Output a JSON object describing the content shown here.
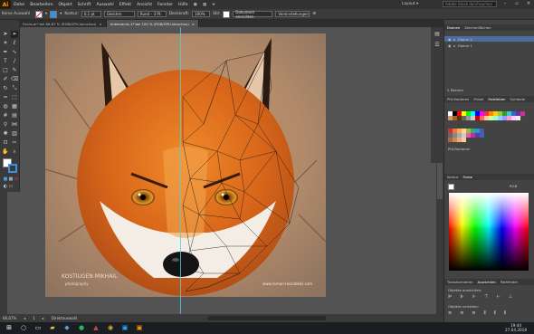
{
  "menubar": {
    "logo": "Ai",
    "items": [
      "Datei",
      "Bearbeiten",
      "Objekt",
      "Schrift",
      "Auswahl",
      "Effekt",
      "Ansicht",
      "Fenster",
      "Hilfe"
    ],
    "layout": "Layout",
    "search_placeholder": "Adobe Stock durchsuchen"
  },
  "controlbar": {
    "label": "Keine Auswahl",
    "stroke_label": "Kontur:",
    "stroke_value": "0,1 pt",
    "brush": "Gleichm.",
    "style": "Rund – 3 Pt.",
    "opacity_label": "Deckkraft:",
    "opacity_value": "100%",
    "style_label": "Stil:",
    "doc_setup": "Dokument einrichten",
    "prefs": "Voreinstellungen"
  },
  "tabs": [
    {
      "label": "Fuchs.ai* bei 66,67 % (RGB/GPU-Vorschau)",
      "close": "×"
    },
    {
      "label": "Unbenannt-1* bei 100 % (RGB/GPU-Vorschau)",
      "close": "×"
    }
  ],
  "status": {
    "zoom": "66,67%",
    "page": "1",
    "tool": "Direktauswahl"
  },
  "watermark": {
    "brand": "KOSTIUGEN MIKHAIL",
    "sub": "photography",
    "url": "www.roman-raisinbkeil.com"
  },
  "panels": {
    "layers_tabs": [
      "Ebenen",
      "Zeichenflächen"
    ],
    "layers": [
      "Ebene 2",
      "Ebene 1"
    ],
    "layers_count": "2 Ebenen",
    "swatches_tabs": [
      "Pfd-Radieren",
      "Pinsel",
      "Farbfelder",
      "Symbole"
    ],
    "swatches_label": "Pfd-Radieren",
    "color_tabs": [
      "Kontur",
      "Farbe"
    ],
    "color_mode": "RGB",
    "transform_tabs": [
      "Transformieren",
      "Ausrichten",
      "Pathfinder"
    ],
    "align_label": "Objekte ausrichten:",
    "distribute_label": "Objekte verteilen:"
  },
  "clock": {
    "time": "19:44",
    "date": "27.04.2018"
  },
  "colors": {
    "accent": "#4ed0e0",
    "selected_layer": "#4b6d9b",
    "ai_orange": "#ff9a00"
  }
}
